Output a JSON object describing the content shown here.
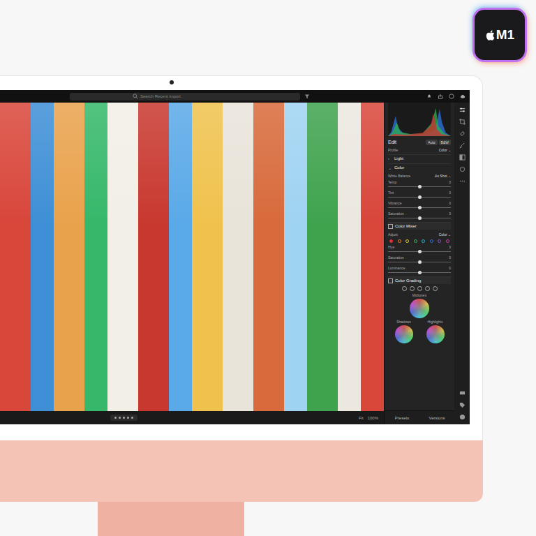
{
  "badge": {
    "label": "M1"
  },
  "toolbar": {
    "search_placeholder": "Search Recent import"
  },
  "panel": {
    "title": "Edit",
    "buttons": [
      "Auto",
      "B&W"
    ],
    "profile": {
      "label": "Profile",
      "value": "Color"
    },
    "light": {
      "label": "Light",
      "expanded": false
    },
    "color": {
      "label": "Color",
      "expanded": true,
      "white_balance": {
        "label": "White Balance",
        "value": "As Shot"
      },
      "sliders": [
        {
          "label": "Temp",
          "value": "0",
          "level": 0.5
        },
        {
          "label": "Tint",
          "value": "0",
          "level": 0.5
        },
        {
          "label": "Vibrance",
          "value": "0",
          "level": 0.5
        },
        {
          "label": "Saturation",
          "value": "0",
          "level": 0.5
        }
      ]
    },
    "color_mixer": {
      "label": "Color Mixer",
      "adjust": {
        "label": "Adjust",
        "value": "Color"
      },
      "swatches": [
        {
          "color": "#e0303a",
          "selected": true
        },
        {
          "color": "#f08a24",
          "selected": false
        },
        {
          "color": "#e8d22a",
          "selected": false
        },
        {
          "color": "#3cb94a",
          "selected": false
        },
        {
          "color": "#2bb8c9",
          "selected": false
        },
        {
          "color": "#3a6fe0",
          "selected": false
        },
        {
          "color": "#8a4fd8",
          "selected": false
        },
        {
          "color": "#d640b8",
          "selected": false
        }
      ],
      "sliders": [
        {
          "label": "Hue",
          "value": "0",
          "level": 0.5
        },
        {
          "label": "Saturation",
          "value": "0",
          "level": 0.5
        },
        {
          "label": "Luminance",
          "value": "0",
          "level": 0.5
        }
      ]
    },
    "color_grading": {
      "label": "Color Grading",
      "midtones": {
        "label": "Midtones"
      },
      "wheels": [
        {
          "label": "Shadows"
        },
        {
          "label": "Highlights"
        }
      ]
    },
    "tabs": [
      {
        "label": "Presets",
        "selected": false
      },
      {
        "label": "Versions",
        "selected": false
      }
    ]
  },
  "status": {
    "fit": "Fit",
    "zoom": "100%"
  }
}
